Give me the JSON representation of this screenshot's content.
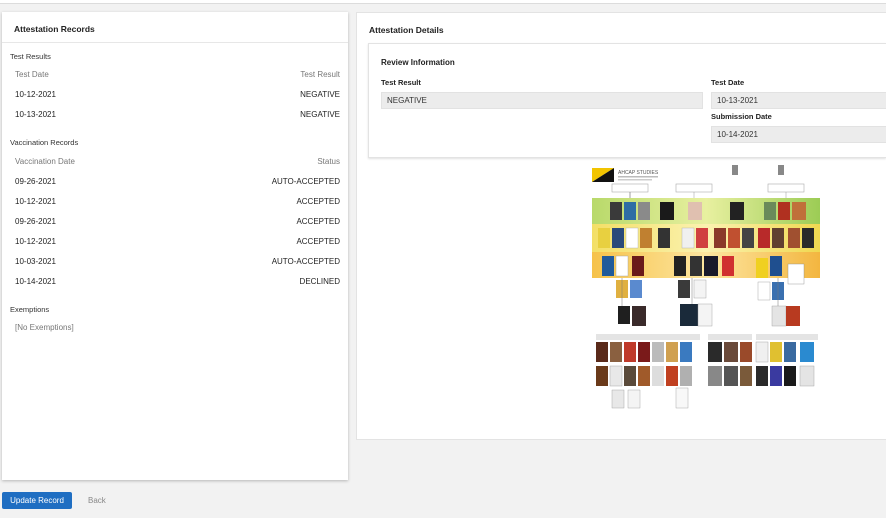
{
  "left_panel": {
    "title": "Attestation Records",
    "test_results": {
      "label": "Test Results",
      "col_date": "Test Date",
      "col_result": "Test Result",
      "rows": [
        {
          "date": "10-12-2021",
          "result": "NEGATIVE"
        },
        {
          "date": "10-13-2021",
          "result": "NEGATIVE"
        }
      ]
    },
    "vaccination_records": {
      "label": "Vaccination Records",
      "col_date": "Vaccination Date",
      "col_status": "Status",
      "rows": [
        {
          "date": "09-26-2021",
          "status": "AUTO-ACCEPTED"
        },
        {
          "date": "10-12-2021",
          "status": "ACCEPTED"
        },
        {
          "date": "09-26-2021",
          "status": "ACCEPTED"
        },
        {
          "date": "10-12-2021",
          "status": "ACCEPTED"
        },
        {
          "date": "10-03-2021",
          "status": "AUTO-ACCEPTED"
        },
        {
          "date": "10-14-2021",
          "status": "DECLINED"
        }
      ]
    },
    "exemptions": {
      "label": "Exemptions",
      "empty_text": "[No Exemptions]"
    }
  },
  "right_panel": {
    "title": "Attestation Details",
    "review": {
      "title": "Review Information",
      "test_result_label": "Test Result",
      "test_result_value": "NEGATIVE",
      "test_date_label": "Test Date",
      "test_date_value": "10-13-2021",
      "submission_date_label": "Submission Date",
      "submission_date_value": "10-14-2021"
    },
    "image": {
      "header_text": "AHCAP STUDIES"
    }
  },
  "actions": {
    "update_label": "Update Record",
    "back_label": "Back"
  },
  "colors": {
    "primary_button": "#1f6ec2",
    "image_accent": "#f2c400"
  }
}
